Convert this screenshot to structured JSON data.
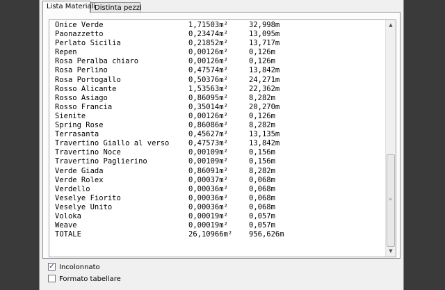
{
  "tabs": [
    {
      "label": "Lista Materiali",
      "active": true
    },
    {
      "label": "Distinta pezzi",
      "active": false
    }
  ],
  "rows": [
    {
      "name": "Onice Verde",
      "area": "1,71503m²",
      "length": "32,998m"
    },
    {
      "name": "Paonazzetto",
      "area": "0,23474m²",
      "length": "13,095m"
    },
    {
      "name": "Perlato Sicilia",
      "area": "0,21852m²",
      "length": "13,717m"
    },
    {
      "name": "Repen",
      "area": "0,00126m²",
      "length": "0,126m"
    },
    {
      "name": "Rosa Peralba chiaro",
      "area": "0,00126m²",
      "length": "0,126m"
    },
    {
      "name": "Rosa Perlino",
      "area": "0,47574m²",
      "length": "13,842m"
    },
    {
      "name": "Rosa Portogallo",
      "area": "0,50376m²",
      "length": "24,271m"
    },
    {
      "name": "Rosso Alicante",
      "area": "1,53563m²",
      "length": "22,362m"
    },
    {
      "name": "Rosso Asiago",
      "area": "0,86095m²",
      "length": "8,282m"
    },
    {
      "name": "Rosso Francia",
      "area": "0,35014m²",
      "length": "20,270m"
    },
    {
      "name": "Sienite",
      "area": "0,00126m²",
      "length": "0,126m"
    },
    {
      "name": "Spring Rose",
      "area": "0,86086m²",
      "length": "8,282m"
    },
    {
      "name": "Terrasanta",
      "area": "0,45627m²",
      "length": "13,135m"
    },
    {
      "name": "Travertino Giallo al verso",
      "area": "0,47573m²",
      "length": "13,842m"
    },
    {
      "name": "Travertino Noce",
      "area": "0,00109m²",
      "length": "0,156m"
    },
    {
      "name": "Travertino Paglierino",
      "area": "0,00109m²",
      "length": "0,156m"
    },
    {
      "name": "Verde Giada",
      "area": "0,86091m²",
      "length": "8,282m"
    },
    {
      "name": "Verde Rolex",
      "area": "0,00037m²",
      "length": "0,068m"
    },
    {
      "name": "Verdello",
      "area": "0,00036m²",
      "length": "0,068m"
    },
    {
      "name": "Veselye Fiorito",
      "area": "0,00036m²",
      "length": "0,068m"
    },
    {
      "name": "Veselye Unito",
      "area": "0,00036m²",
      "length": "0,068m"
    },
    {
      "name": "Voloka",
      "area": "0,00019m²",
      "length": "0,057m"
    },
    {
      "name": "Weave",
      "area": "0,00019m²",
      "length": "0,057m"
    },
    {
      "name": "TOTALE",
      "area": "26,10966m²",
      "length": "956,626m"
    }
  ],
  "scrollbar": {
    "up_icon": "arrow-up-icon",
    "down_icon": "arrow-down-icon",
    "up_glyph": "▲",
    "down_glyph": "▼"
  },
  "options": {
    "incolonnato": {
      "label": "Incolonnato",
      "checked": true,
      "mark": "✓"
    },
    "formato_tabellare": {
      "label": "Formato tabellare",
      "checked": false
    }
  }
}
